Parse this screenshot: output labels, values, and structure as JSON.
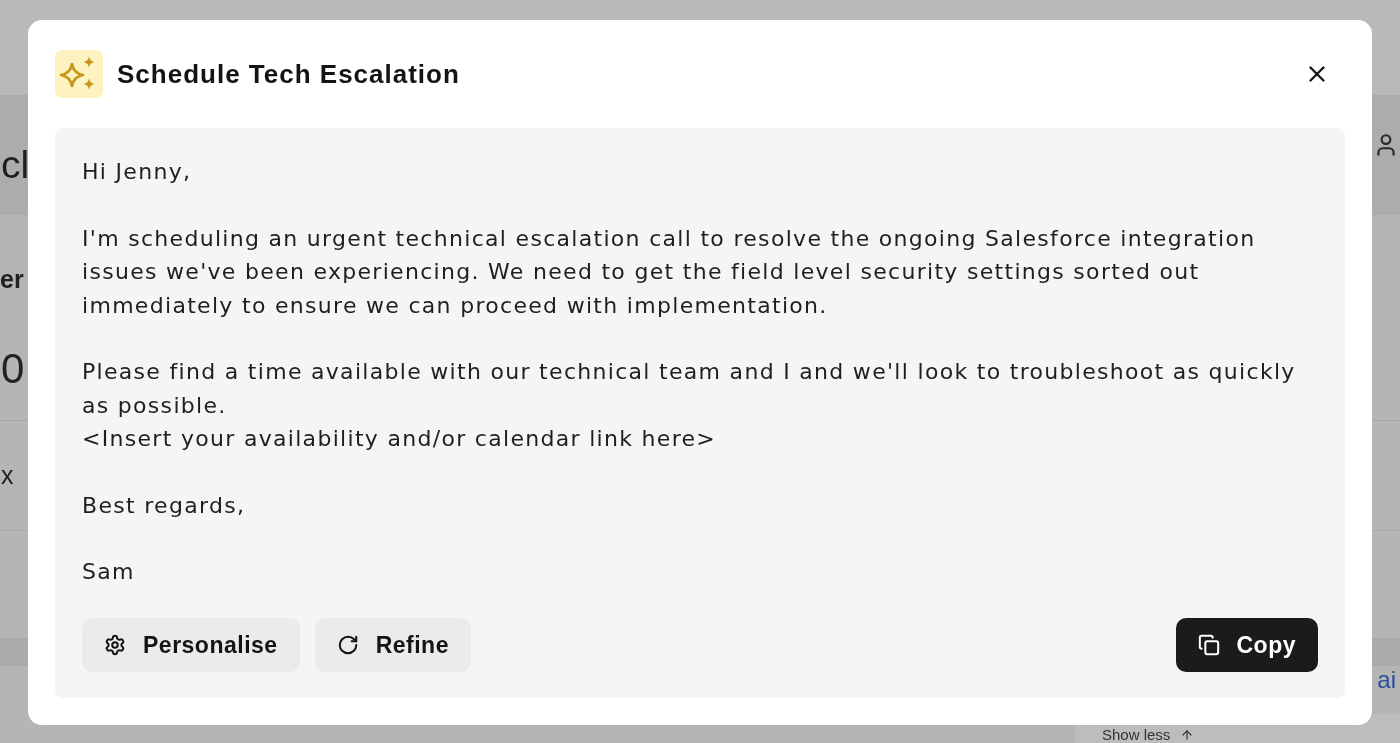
{
  "background_page": {
    "heading_fragment": "cl",
    "label_fragment": "er",
    "number_fragment": "0",
    "row_fragment": "x",
    "link_fragment": "ai",
    "show_less": "Show less"
  },
  "dialog": {
    "title": "Schedule Tech Escalation",
    "message": {
      "paragraphs": [
        {
          "lines": [
            "Hi Jenny,"
          ]
        },
        {
          "lines": [
            "I'm scheduling an urgent technical escalation call to resolve the ongoing Salesforce integration issues we've been experiencing. We need to get the field level security settings sorted out immediately to ensure we can proceed with implementation."
          ]
        },
        {
          "lines": [
            "Please find a time available with our technical team and I and we'll look to troubleshoot as quickly as possible.",
            "<Insert your availability and/or calendar link here>"
          ]
        },
        {
          "lines": [
            "Best regards,"
          ]
        },
        {
          "lines": [
            "Sam"
          ]
        }
      ]
    },
    "actions": [
      {
        "label": "Personalise",
        "kind": "secondary"
      },
      {
        "label": "Refine",
        "kind": "secondary"
      },
      {
        "label": "Copy",
        "kind": "primary"
      }
    ]
  }
}
